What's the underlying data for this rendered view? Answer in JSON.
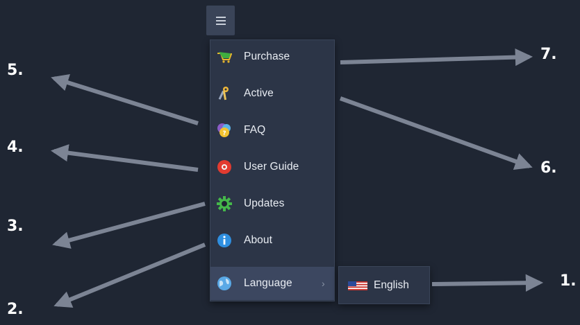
{
  "menu": {
    "items": [
      {
        "label": "Purchase",
        "icon": "cart-icon"
      },
      {
        "label": "Active",
        "icon": "key-icon"
      },
      {
        "label": "FAQ",
        "icon": "faq-icon"
      },
      {
        "label": "User Guide",
        "icon": "lifebuoy-icon"
      },
      {
        "label": "Updates",
        "icon": "gear-icon"
      },
      {
        "label": "About",
        "icon": "info-icon"
      },
      {
        "label": "Language",
        "icon": "globe-icon",
        "submenu_indicator": "›"
      }
    ]
  },
  "language_submenu": {
    "items": [
      {
        "label": "English",
        "icon": "us-flag-icon"
      }
    ]
  },
  "callouts": [
    "1.",
    "2.",
    "3.",
    "4.",
    "5.",
    "6.",
    "7."
  ],
  "colors": {
    "background": "#1f2633",
    "panel": "#2c3547",
    "arrow": "#7c8494",
    "text": "#e9edf3"
  }
}
